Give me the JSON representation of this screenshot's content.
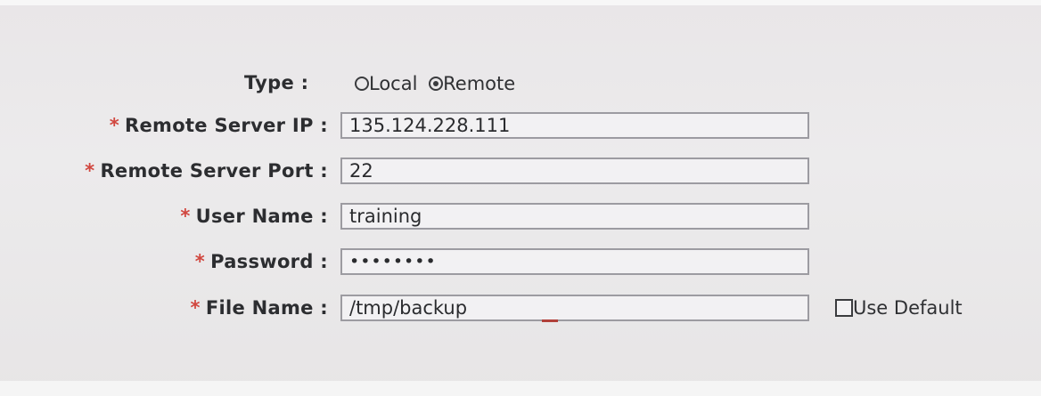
{
  "form": {
    "type": {
      "label": "Type :",
      "options": [
        {
          "label": "Local",
          "selected": false
        },
        {
          "label": "Remote",
          "selected": true
        }
      ]
    },
    "required_marker": "*",
    "remote_server_ip": {
      "label": "Remote Server IP :",
      "value": "135.124.228.111"
    },
    "remote_server_port": {
      "label": "Remote Server Port :",
      "value": "22"
    },
    "user_name": {
      "label": "User Name :",
      "value": "training"
    },
    "password": {
      "label": "Password :",
      "value": "••••••••"
    },
    "file_name": {
      "label": "File Name :",
      "value": "/tmp/backup"
    },
    "use_default": {
      "label": "Use Default",
      "checked": false
    }
  },
  "colors": {
    "background": "#eceaeb",
    "required_marker": "#d1473f",
    "field_border": "#9c9ba1"
  }
}
